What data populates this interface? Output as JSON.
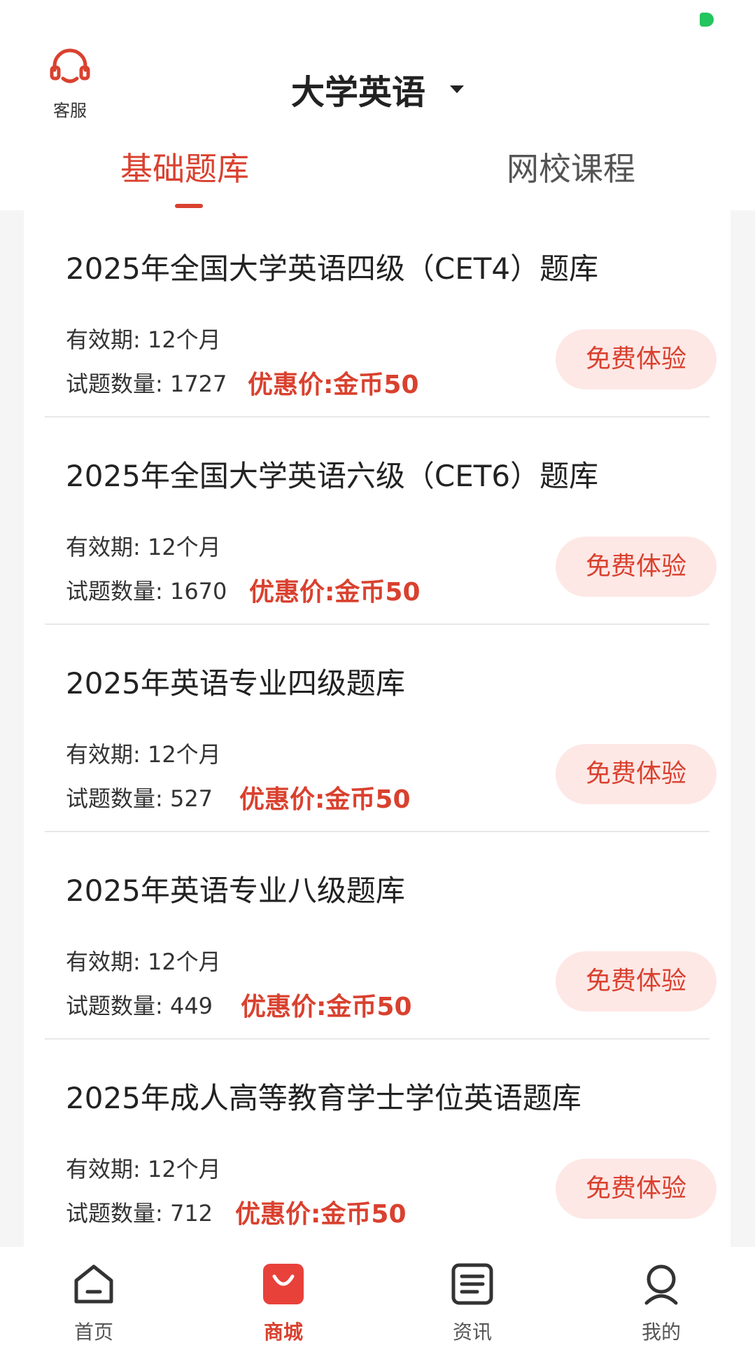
{
  "header": {
    "customer_service_label": "客服",
    "title": "大学英语",
    "tabs": [
      {
        "label": "基础题库"
      },
      {
        "label": "网校课程"
      }
    ]
  },
  "items": [
    {
      "title": "2025年全国大学英语四级（CET4）题库",
      "validity": "有效期: 12个月",
      "count": "试题数量: 1727",
      "price": "优惠价:金币50",
      "button": "免费体验"
    },
    {
      "title": "2025年全国大学英语六级（CET6）题库",
      "validity": "有效期: 12个月",
      "count": "试题数量: 1670",
      "price": "优惠价:金币50",
      "button": "免费体验"
    },
    {
      "title": "2025年英语专业四级题库",
      "validity": "有效期: 12个月",
      "count": "试题数量: 527",
      "price": "优惠价:金币50",
      "button": "免费体验"
    },
    {
      "title": "2025年英语专业八级题库",
      "validity": "有效期: 12个月",
      "count": "试题数量: 449",
      "price": "优惠价:金币50",
      "button": "免费体验"
    },
    {
      "title": "2025年成人高等教育学士学位英语题库",
      "validity": "有效期: 12个月",
      "count": "试题数量: 712",
      "price": "优惠价:金币50",
      "button": "免费体验"
    }
  ],
  "bottom_nav": [
    {
      "label": "首页",
      "icon": "home-icon"
    },
    {
      "label": "商城",
      "icon": "shop-bag-icon"
    },
    {
      "label": "资讯",
      "icon": "news-icon"
    },
    {
      "label": "我的",
      "icon": "profile-icon"
    }
  ],
  "colors": {
    "accent": "#d9412f",
    "button_bg": "#fde8e6",
    "status_dot": "#22c55e"
  }
}
